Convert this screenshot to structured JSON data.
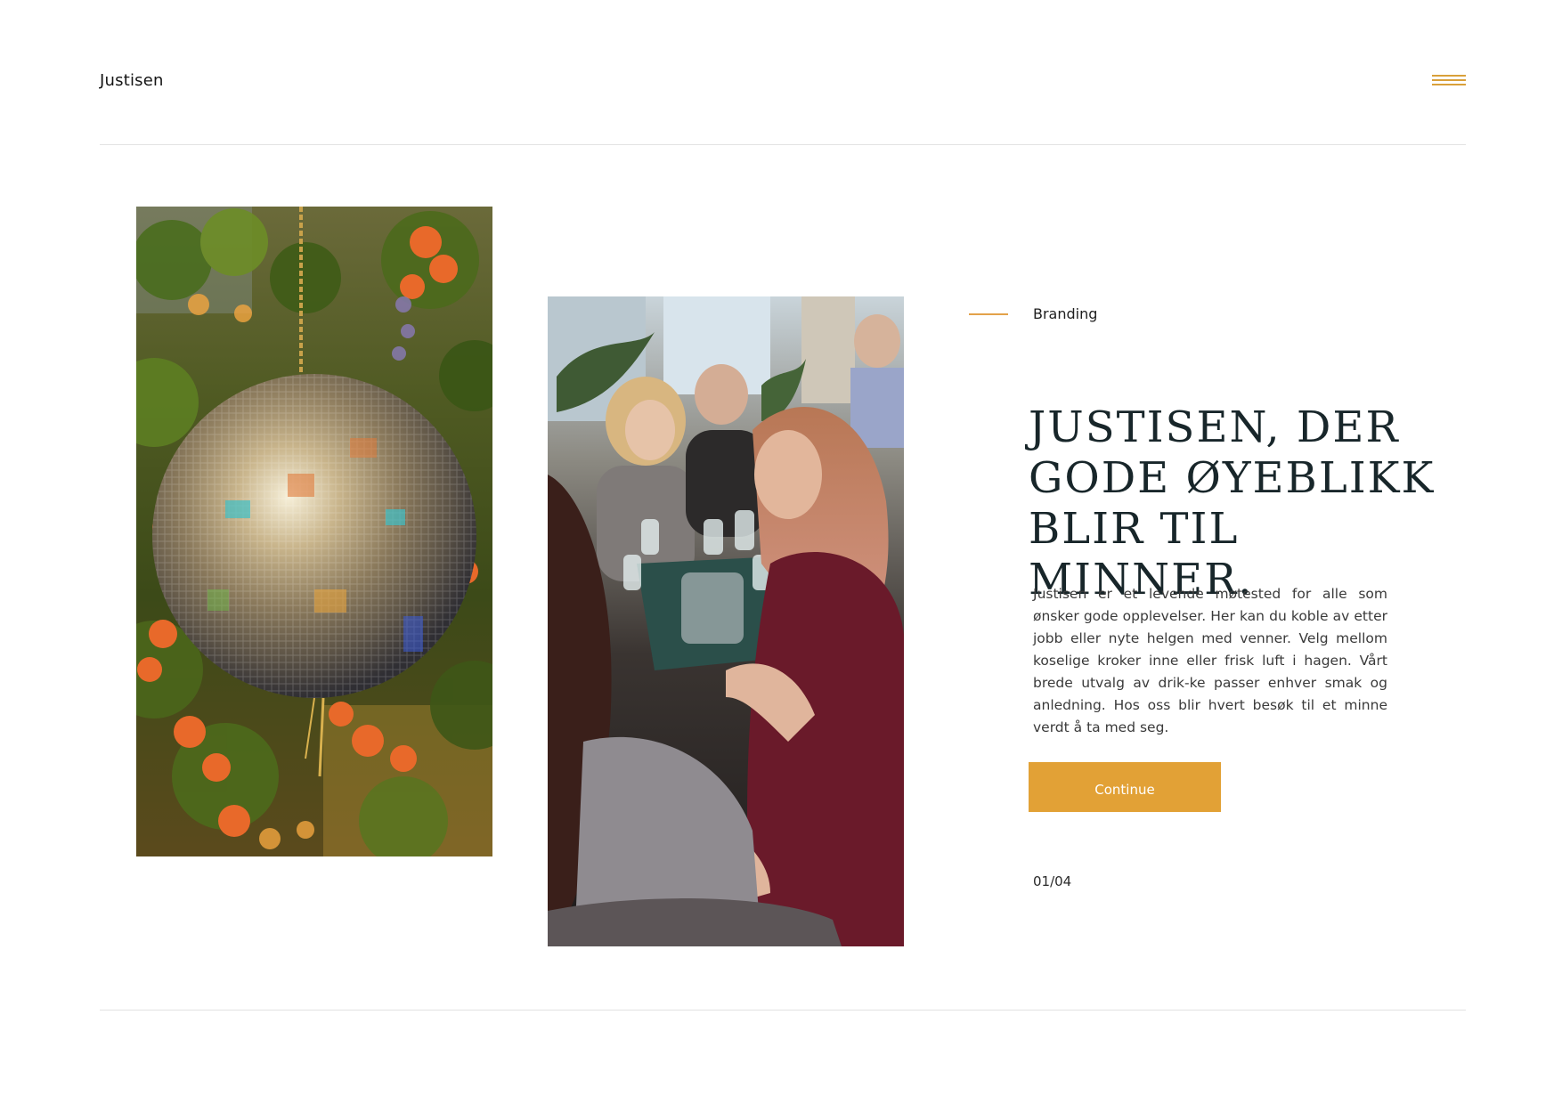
{
  "header": {
    "brand": "Justisen",
    "menu_icon": "hamburger-menu-icon"
  },
  "images": {
    "disco": "disco-ball-photo",
    "people": "guests-at-table-photo"
  },
  "hero": {
    "eyebrow": "Branding",
    "title": "JUSTISEN, DER GODE ØYEBLIKK BLIR TIL MINNER.",
    "body": "Justisen er et levende møtested for alle som ønsker gode opplevelser. Her kan du koble av etter jobb eller nyte helgen med venner. Velg mellom koselige kroker inne eller frisk luft i hagen. Vårt brede utvalg av drik-ke passer enhver smak og anledning. Hos oss blir hvert besøk til et minne verdt å ta med seg.",
    "cta_label": "Continue",
    "counter": "01/04"
  },
  "colors": {
    "accent": "#e2a136",
    "headline": "#18262a",
    "rule": "#e2e2e2"
  }
}
